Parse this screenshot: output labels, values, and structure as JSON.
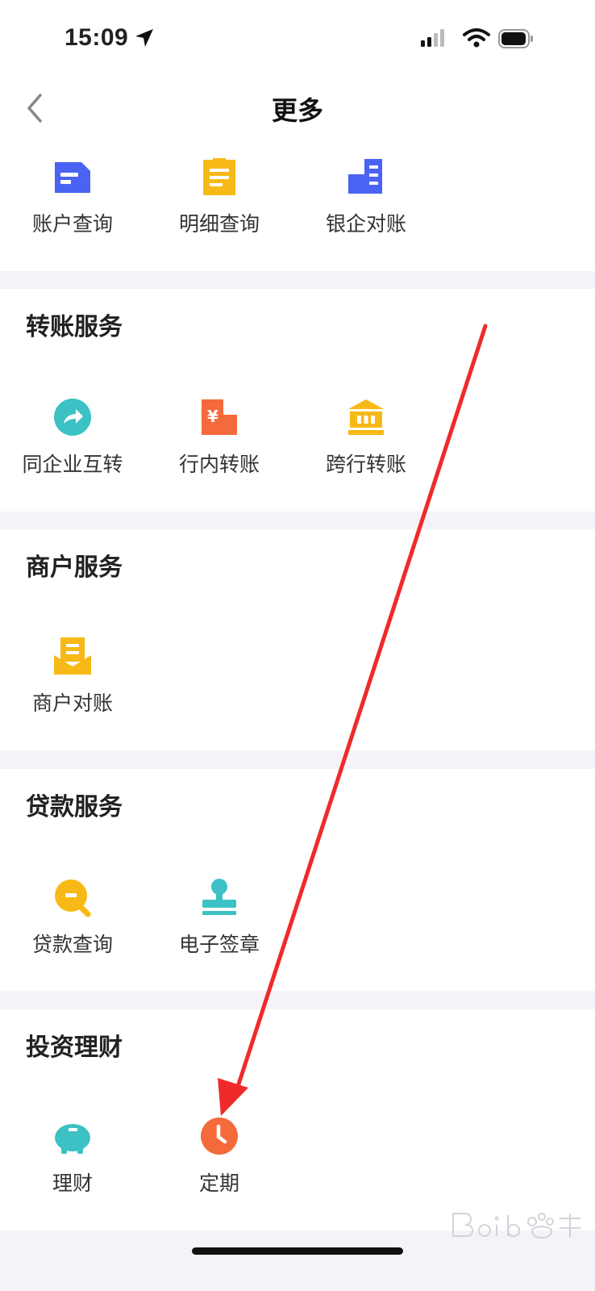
{
  "status_bar": {
    "time": "15:09"
  },
  "header": {
    "title": "更多"
  },
  "sections": [
    {
      "title": "",
      "items": [
        {
          "label": "账户查询",
          "icon": "account-query-icon"
        },
        {
          "label": "明细查询",
          "icon": "detail-query-icon"
        },
        {
          "label": "银企对账",
          "icon": "bank-reconcile-icon"
        }
      ]
    },
    {
      "title": "转账服务",
      "items": [
        {
          "label": "同企业互转",
          "icon": "same-company-transfer-icon"
        },
        {
          "label": "行内转账",
          "icon": "intrabank-transfer-icon"
        },
        {
          "label": "跨行转账",
          "icon": "interbank-transfer-icon"
        }
      ]
    },
    {
      "title": "商户服务",
      "items": [
        {
          "label": "商户对账",
          "icon": "merchant-reconcile-icon"
        }
      ]
    },
    {
      "title": "贷款服务",
      "items": [
        {
          "label": "贷款查询",
          "icon": "loan-query-icon"
        },
        {
          "label": "电子签章",
          "icon": "e-seal-icon"
        }
      ]
    },
    {
      "title": "投资理财",
      "items": [
        {
          "label": "理财",
          "icon": "piggy-bank-icon"
        },
        {
          "label": "定期",
          "icon": "clock-icon"
        }
      ]
    }
  ],
  "colors": {
    "blue": "#4a63f2",
    "yellow": "#f7b916",
    "teal": "#3cc1c4",
    "orange": "#f56a3a",
    "annotation_red": "#f02a2a"
  }
}
